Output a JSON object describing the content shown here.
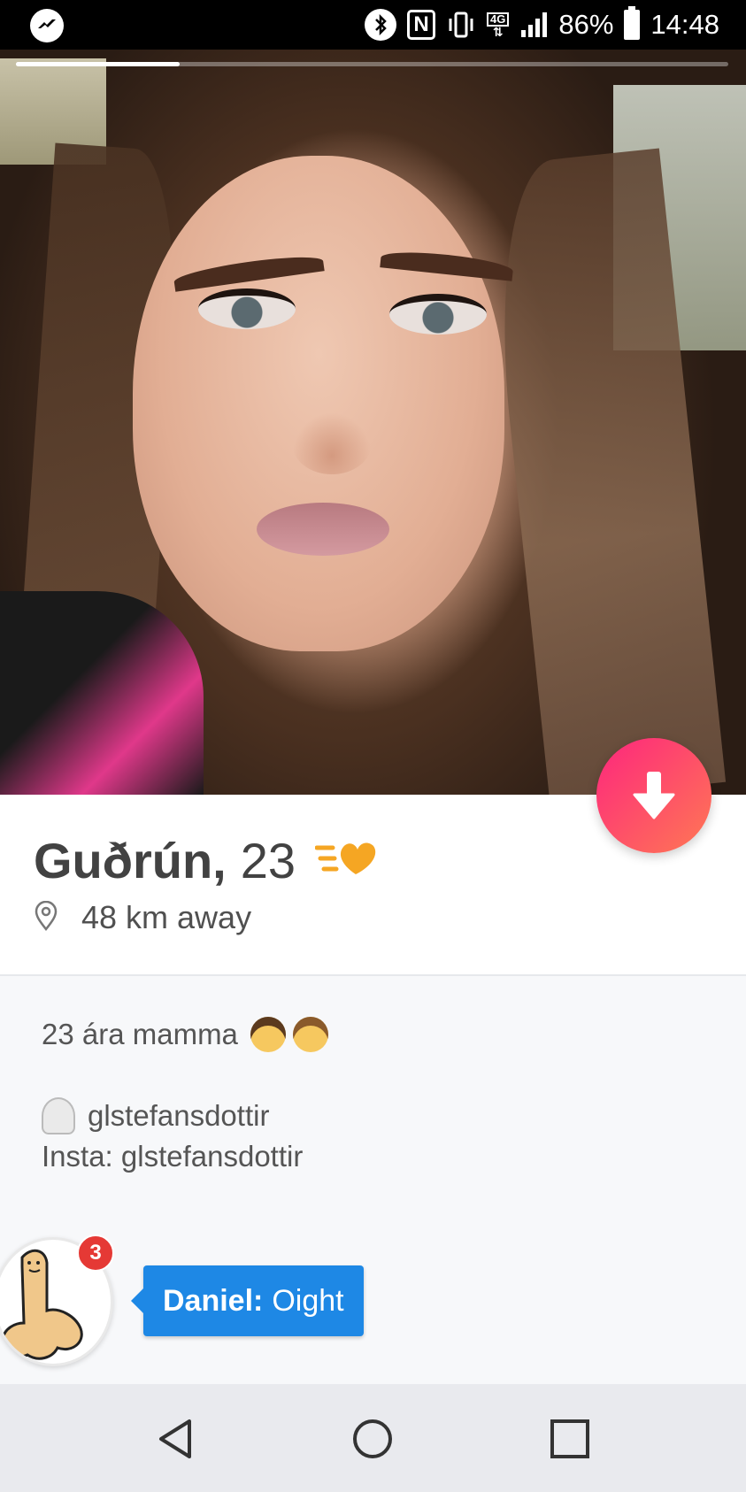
{
  "status_bar": {
    "messenger_icon": "messenger-icon",
    "icons": [
      "bluetooth-icon",
      "nfc-icon",
      "vibrate-icon",
      "4g-icon",
      "signal-icon"
    ],
    "network_label": "4G",
    "nfc_label": "N",
    "battery": "86%",
    "time": "14:48"
  },
  "photo": {
    "progress_fraction": 0.23
  },
  "profile": {
    "name": "Guðrún,",
    "age": "23",
    "distance": "48 km away",
    "super_like_icon": "super-like-heart-icon",
    "location_icon": "location-pin-icon",
    "down_button_icon": "arrow-down-icon"
  },
  "bio": {
    "line1": "23 ára mamma",
    "line1_emojis": [
      "woman-emoji",
      "girl-emoji"
    ],
    "snapchat_icon": "ghost-icon",
    "snapchat": "glstefansdottir",
    "insta": "Insta: glstefansdottir"
  },
  "chat_head": {
    "badge": "3",
    "sender": "Daniel:",
    "message": "Oight"
  },
  "nav": {
    "back_icon": "back-triangle-icon",
    "home_icon": "home-circle-icon",
    "recents_icon": "recents-square-icon"
  },
  "colors": {
    "fab_start": "#fd267d",
    "fab_end": "#ff7854",
    "bubble": "#1e88e5",
    "badge": "#e53935",
    "super_like": "#f5a623"
  }
}
